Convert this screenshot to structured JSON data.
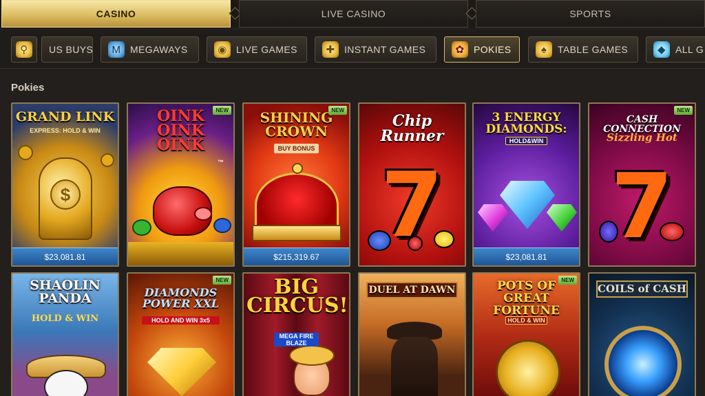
{
  "top_tabs": [
    {
      "label": "CASINO"
    },
    {
      "label": "LIVE CASINO"
    },
    {
      "label": "SPORTS"
    }
  ],
  "categories": [
    {
      "label": "US BUYS",
      "icon": "search-icon"
    },
    {
      "label": "MEGAWAYS",
      "icon": "megaways-icon"
    },
    {
      "label": "LIVE GAMES",
      "icon": "chips-icon"
    },
    {
      "label": "INSTANT GAMES",
      "icon": "gamepad-icon"
    },
    {
      "label": "POKIES",
      "icon": "cherries-icon"
    },
    {
      "label": "TABLE GAMES",
      "icon": "spade-icon"
    },
    {
      "label": "ALL G",
      "icon": "diamond-icon"
    }
  ],
  "section": {
    "title": "Pokies"
  },
  "games": [
    {
      "title_line1": "GRAND LINK",
      "title_line2": "EXPRESS: HOLD & WIN",
      "jackpot": "$23,081.81",
      "new": false
    },
    {
      "title_line1": "OINK OINK OINK",
      "title_line2": "™",
      "jackpot": "",
      "new": true
    },
    {
      "title_line1": "SHINING CROWN",
      "title_line2": "BUY BONUS",
      "jackpot": "$215,319.67",
      "new": true
    },
    {
      "title_line1": "Chip Runner",
      "title_line2": "",
      "jackpot": "",
      "new": false
    },
    {
      "title_line1": "3 ENERGY DIAMONDS:",
      "title_line2": "HOLD&WIN",
      "jackpot": "$23,081.81",
      "new": false
    },
    {
      "title_line1": "CASH CONNECTION",
      "title_line2": "Sizzling Hot",
      "jackpot": "",
      "new": true
    },
    {
      "title_line1": "SHAOLIN PANDA",
      "title_line2": "HOLD & WIN",
      "jackpot": "",
      "new": false
    },
    {
      "title_line1": "DIAMONDS POWER XXL",
      "title_line2": "HOLD AND WIN 3x5",
      "jackpot": "",
      "new": true
    },
    {
      "title_line1": "BIG CIRCUS!",
      "title_line2": "MEGA FIRE BLAZE",
      "jackpot": "",
      "new": false
    },
    {
      "title_line1": "DUEL AT DAWN",
      "title_line2": "",
      "jackpot": "",
      "new": false
    },
    {
      "title_line1": "POTS OF GREAT FORTUNE",
      "title_line2": "HOLD & WIN",
      "jackpot": "",
      "new": true
    },
    {
      "title_line1": "COILS of CASH",
      "title_line2": "",
      "jackpot": "",
      "new": false
    }
  ],
  "badge_text": "NEW",
  "colors": {
    "accent_gold": "#dcbd62",
    "jackpot_blue": "#2a6db0",
    "new_green": "#7cc44c",
    "background": "#231f1c"
  }
}
